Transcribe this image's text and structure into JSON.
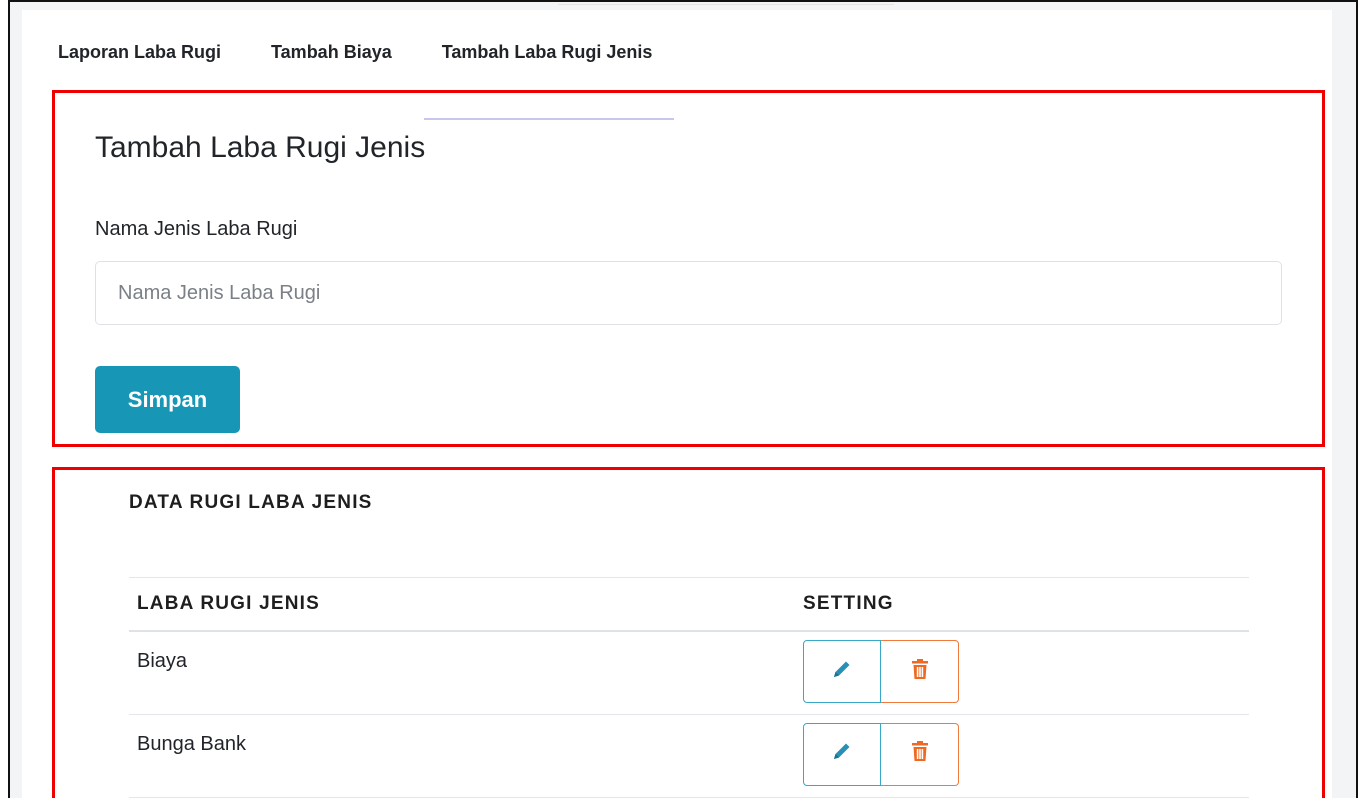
{
  "tabs": [
    {
      "label": "Laporan Laba Rugi",
      "active": false
    },
    {
      "label": "Tambah Biaya",
      "active": false
    },
    {
      "label": "Tambah Laba Rugi Jenis",
      "active": true
    }
  ],
  "form": {
    "title": "Tambah Laba Rugi Jenis",
    "field_label": "Nama Jenis Laba Rugi",
    "field_placeholder": "Nama Jenis Laba Rugi",
    "field_value": "",
    "save_label": "Simpan"
  },
  "table": {
    "heading": "DATA RUGI LABA JENIS",
    "columns": [
      "LABA RUGI JENIS",
      "SETTING"
    ],
    "rows": [
      {
        "name": "Biaya",
        "actions": [
          "pencil-icon",
          "trash-icon"
        ]
      },
      {
        "name": "Bunga Bank",
        "actions": [
          "pencil-icon",
          "trash-icon"
        ]
      }
    ]
  },
  "colors": {
    "primary_button": "#1796b6",
    "edit_outline": "#38a8c8",
    "delete_outline": "#f07a3b",
    "highlight_box": "#ef0000"
  }
}
